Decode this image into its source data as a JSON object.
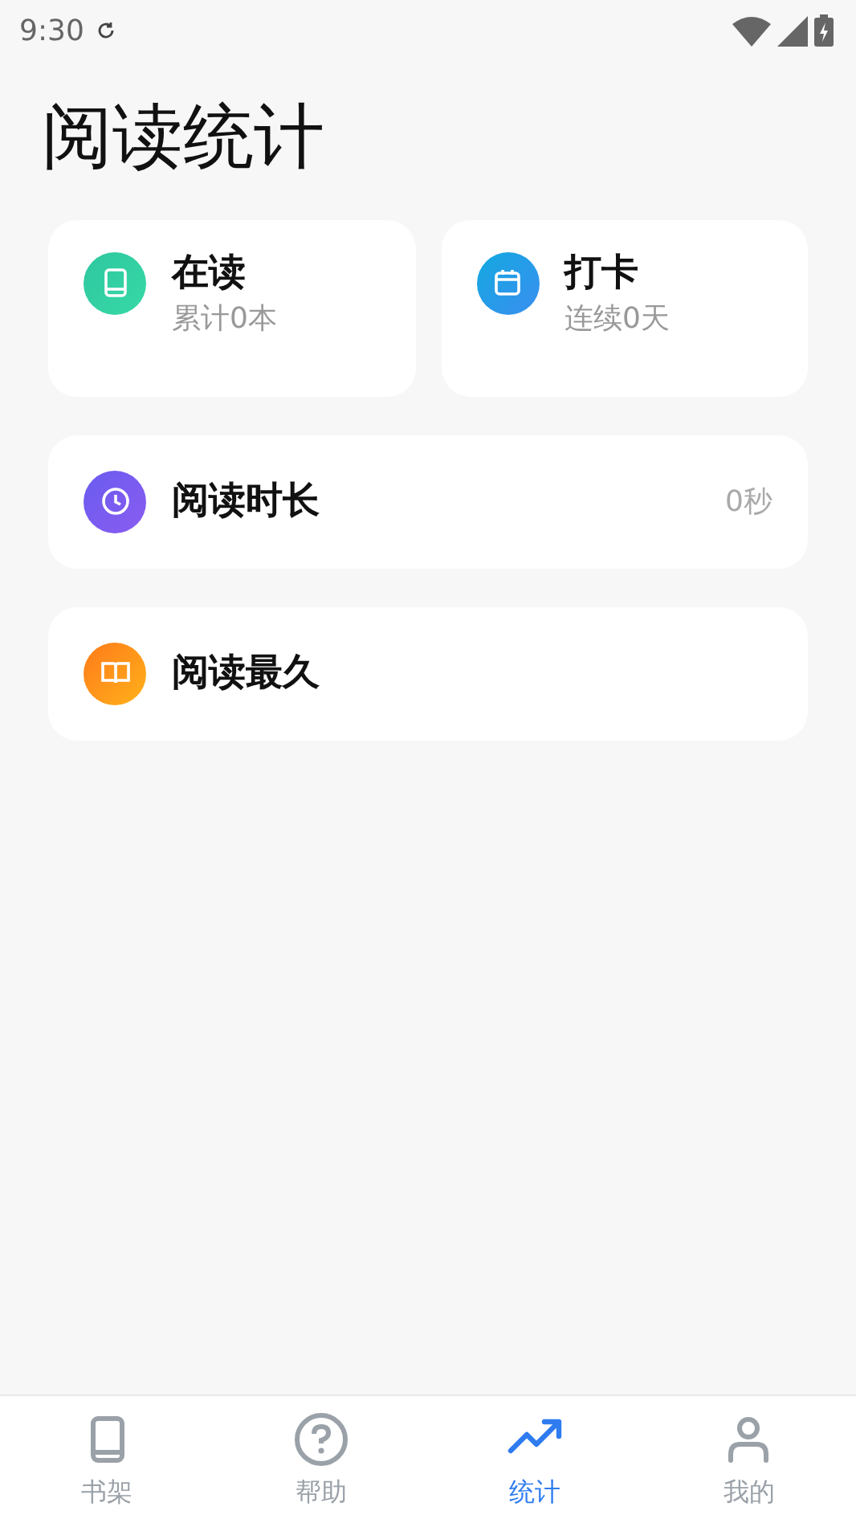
{
  "status_bar": {
    "time": "9:30"
  },
  "page_title": "阅读统计",
  "summary_cards": [
    {
      "title": "在读",
      "subtitle": "累计0本"
    },
    {
      "title": "打卡",
      "subtitle": "连续0天"
    }
  ],
  "stat_rows": [
    {
      "title": "阅读时长",
      "value": "0秒"
    },
    {
      "title": "阅读最久"
    }
  ],
  "tabs": [
    {
      "label": "书架",
      "selected": false
    },
    {
      "label": "帮助",
      "selected": false
    },
    {
      "label": "统计",
      "selected": true
    },
    {
      "label": "我的",
      "selected": false
    }
  ]
}
